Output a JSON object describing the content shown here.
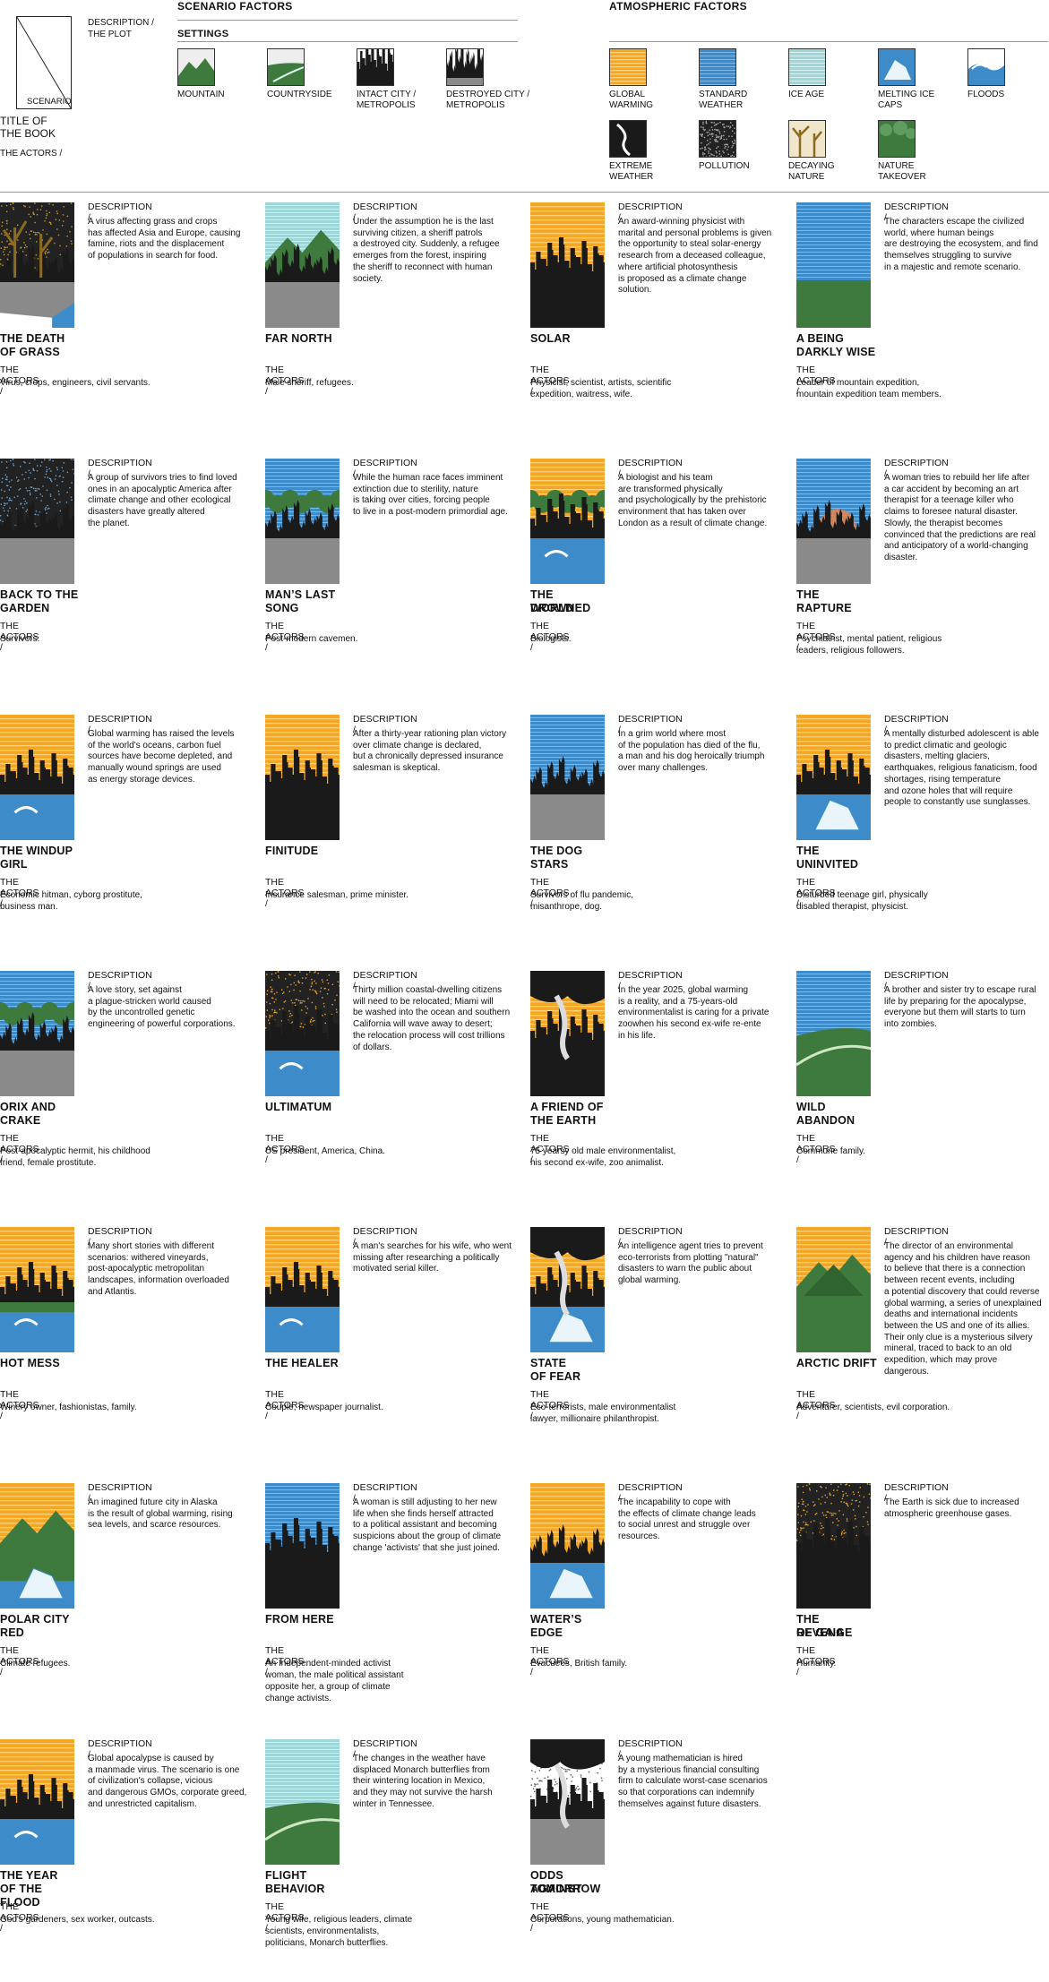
{
  "legend": {
    "description_label": "DESCRIPTION /",
    "plot_label": "THE PLOT",
    "scenario_label": "SCENARIO",
    "title_label_1": "TITLE OF",
    "title_label_2": "THE BOOK",
    "actors_label": "THE ACTORS /"
  },
  "scenario_factors": {
    "heading": "SCENARIO FACTORS",
    "settings_heading": "SETTINGS",
    "settings": [
      {
        "icon": "mountain-icon",
        "label_1": "MOUNTAIN",
        "label_2": ""
      },
      {
        "icon": "countryside-icon",
        "label_1": "COUNTRYSIDE",
        "label_2": ""
      },
      {
        "icon": "intact-city-icon",
        "label_1": "INTACT CITY /",
        "label_2": "METROPOLIS"
      },
      {
        "icon": "destroyed-city-icon",
        "label_1": "DESTROYED CITY /",
        "label_2": "METROPOLIS"
      }
    ]
  },
  "atmospheric_factors": {
    "heading": "ATMOSPHERIC FACTORS",
    "items": [
      {
        "icon": "global-warming-icon",
        "label_1": "GLOBAL",
        "label_2": "WARMING"
      },
      {
        "icon": "standard-weather-icon",
        "label_1": "STANDARD",
        "label_2": "WEATHER"
      },
      {
        "icon": "ice-age-icon",
        "label_1": "ICE AGE",
        "label_2": ""
      },
      {
        "icon": "melting-ice-caps-icon",
        "label_1": "MELTING ICE",
        "label_2": "CAPS"
      },
      {
        "icon": "floods-icon",
        "label_1": "FLOODS",
        "label_2": ""
      },
      {
        "icon": "extreme-weather-icon",
        "label_1": "EXTREME",
        "label_2": "WEATHER"
      },
      {
        "icon": "pollution-icon",
        "label_1": "POLLUTION",
        "label_2": ""
      },
      {
        "icon": "decaying-nature-icon",
        "label_1": "DECAYING",
        "label_2": "NATURE"
      },
      {
        "icon": "nature-takeover-icon",
        "label_1": "NATURE",
        "label_2": "TAKEOVER"
      }
    ]
  },
  "colors": {
    "orange": "#f5a623",
    "blue": "#3d8cc9",
    "light_blue": "#9fd6d8",
    "green": "#3e7a3e",
    "gray": "#8a8a8a",
    "black": "#1a1a1a",
    "decay": "#8c6b1f",
    "red": "#d9351c"
  },
  "desc_label": "DESCRIPTION /",
  "actors_label": "THE ACTORS /",
  "books": [
    {
      "t1": "THE DEATH",
      "t2": "OF GRASS",
      "desc": [
        "A virus affecting grass and crops",
        "has affected Asia and Europe, causing",
        "famine, riots and  the displacement",
        "of populations in search for food."
      ],
      "actors": [
        "Virus, crops, engineers, civil servants."
      ],
      "sky": "decay",
      "ground": "gray",
      "city": "destroyed",
      "extra": "decay"
    },
    {
      "t1": "FAR NORTH",
      "t2": "",
      "desc": [
        "Under the assumption he is the last",
        "surviving citizen, a sheriff  patrols",
        "a destroyed city. Suddenly, a refugee",
        "emerges from the forest, inspiring",
        "the sheriff to reconnect with human",
        "society."
      ],
      "actors": [
        "Male sheriff, refugees."
      ],
      "sky": "lightblue",
      "ground": "gray",
      "city": "destroyed",
      "extra": "mountain"
    },
    {
      "t1": "SOLAR",
      "t2": "",
      "desc": [
        "An award-winning physicist with",
        "marital and personal problems is given",
        "the opportunity to steal solar-energy",
        "research from a deceased colleague,",
        "where artificial photosynthesis",
        "is proposed as a climate change",
        "solution."
      ],
      "actors": [
        "Physicist, scientist, artists, scientific",
        "expedition, waitress, wife."
      ],
      "sky": "orange",
      "ground": "black",
      "city": "intact",
      "extra": ""
    },
    {
      "t1": "A BEING",
      "t2": "DARKLY WISE",
      "desc": [
        "The characters escape the civilized",
        "world, where human beings",
        "are destroying the ecosystem, and find",
        "themselves struggling to survive",
        "in a majestic and remote scenario."
      ],
      "actors": [
        "Leader of mountain expedition,",
        "mountain expedition team members."
      ],
      "sky": "blue",
      "ground": "green",
      "city": "",
      "extra": "bear"
    },
    {
      "t1": "BACK TO THE",
      "t2": "GARDEN",
      "desc": [
        "A group of survivors tries to find loved",
        "ones in an apocalyptic America after",
        "climate change and other ecological",
        "disasters have greatly altered",
        "the planet."
      ],
      "actors": [
        "Survivors."
      ],
      "sky": "pollution",
      "ground": "gray",
      "city": "destroyed",
      "extra": ""
    },
    {
      "t1": "MAN’S LAST",
      "t2": "SONG",
      "desc": [
        "While the human race faces imminent",
        "extinction due to sterility, nature",
        "is taking over cities, forcing people",
        "to live in a post-modern primordial age."
      ],
      "actors": [
        "Post-modern cavemen."
      ],
      "sky": "blue",
      "ground": "gray",
      "city": "destroyed",
      "extra": "jungle"
    },
    {
      "t1": "THE DROWNED",
      "t2": "WORLD",
      "desc": [
        "A biologist and his team",
        "are transformed physically",
        "and psychologically by the prehistoric",
        "environment that has taken over",
        "London as a result of climate change."
      ],
      "actors": [
        "Biologists."
      ],
      "sky": "orange",
      "ground": "blue",
      "city": "intact",
      "extra": "jungle-croc"
    },
    {
      "t1": "THE RAPTURE",
      "t2": "",
      "desc": [
        "A woman tries to rebuild her life after",
        "a car accident by becoming an art",
        "therapist for a teenage killer who",
        "claims to foresee natural disaster.",
        "Slowly, the therapist becomes",
        "convinced that the predictions are real",
        "and anticipatory of a world-changing",
        "disaster."
      ],
      "actors": [
        "Psychiatrist, mental patient, religious",
        "leaders, religious followers."
      ],
      "sky": "bluesun",
      "ground": "gray",
      "city": "destroyed",
      "extra": ""
    },
    {
      "t1": "THE WINDUP",
      "t2": "GIRL",
      "desc": [
        "Global warming has raised the levels",
        "of the world's oceans, carbon fuel",
        "sources have become depleted, and",
        "manually wound springs are used",
        "as energy storage devices."
      ],
      "actors": [
        "Economic hitman, cyborg prostitute,",
        "business man."
      ],
      "sky": "orange",
      "ground": "blue",
      "city": "intact",
      "extra": "wave"
    },
    {
      "t1": "FINITUDE",
      "t2": "",
      "desc": [
        "After a thirty-year rationing plan victory",
        "over climate change is declared,",
        "but a chronically depressed insurance",
        "salesman is skeptical."
      ],
      "actors": [
        "Insurance salesman, prime minister."
      ],
      "sky": "orange",
      "ground": "black",
      "city": "intact",
      "extra": "tiger"
    },
    {
      "t1": "THE DOG",
      "t2": "STARS",
      "desc": [
        "In a grim world where most",
        "of the population has died of the flu,",
        "a man and his dog heroically triumph",
        "over many challenges."
      ],
      "actors": [
        "Survivors of flu pandemic,",
        "misanthrope, dog."
      ],
      "sky": "blue",
      "ground": "gray",
      "city": "destroyed",
      "extra": "plane-dog"
    },
    {
      "t1": "THE",
      "t2": "UNINVITED",
      "desc": [
        "A mentally disturbed adolescent is able",
        "to predict climatic and geologic",
        "disasters, melting glaciers,",
        "earthquakes, religious fanaticism, food",
        "shortages, rising temperature",
        "and ozone holes that will require",
        "people to constantly use sunglasses."
      ],
      "actors": [
        "Disturbed teenage girl, physically",
        "disabled therapist, physicist."
      ],
      "sky": "orange",
      "ground": "blue",
      "city": "intact",
      "extra": "ice"
    },
    {
      "t1": "ORIX AND",
      "t2": "CRAKE",
      "desc": [
        "A love story, set against",
        "a plague-stricken world caused",
        "by the uncontrolled genetic",
        "engineering of powerful corporations."
      ],
      "actors": [
        "Post-apocalyptic hermit, his childhood",
        "friend, female prostitute."
      ],
      "sky": "blue",
      "ground": "gray",
      "city": "destroyed",
      "extra": "jungle-dog"
    },
    {
      "t1": "ULTIMATUM",
      "t2": "",
      "desc": [
        "Thirty million coastal-dwelling citizens",
        "will need to be relocated; Miami will",
        "be washed into the ocean and southern",
        "California will wave away to desert;",
        "the relocation process will cost trillions",
        "of dollars."
      ],
      "actors": [
        "US president, America, China."
      ],
      "sky": "pollution-orange",
      "ground": "blue",
      "city": "intact",
      "extra": "wave"
    },
    {
      "t1": "A FRIEND OF",
      "t2": "THE EARTH",
      "desc": [
        "In the year 2025, global warming",
        "is a reality, and a 75-years-old",
        "environmentalist is caring for a private",
        "zoowhen his second ex-wife re-ente",
        "in his life."
      ],
      "actors": [
        "75 yearsy old male environmentalist,",
        "his second ex-wife, zoo animalist."
      ],
      "sky": "orange-storm",
      "ground": "black",
      "city": "intact",
      "extra": "tornado"
    },
    {
      "t1": "WILD",
      "t2": "ABANDON",
      "desc": [
        "A brother and sister try to escape rural",
        "life by preparing for the apocalypse,",
        "everyone but them will starts to turn",
        "into zombies."
      ],
      "actors": [
        "Commune family."
      ],
      "sky": "blue",
      "ground": "green",
      "city": "",
      "extra": "hill"
    },
    {
      "t1": "HOT MESS",
      "t2": "",
      "desc": [
        "Many short stories with different",
        "scenarios: withered vineyards,",
        "post-apocalyptic metropolitan",
        "landscapes, information overloaded",
        "and Atlantis."
      ],
      "actors": [
        "Winery owner, fashionistas, family."
      ],
      "sky": "orange",
      "ground": "blue",
      "city": "intact",
      "extra": "wave-green"
    },
    {
      "t1": "THE HEALER",
      "t2": "",
      "desc": [
        "A man's searches for his wife, who went",
        "missing after researching a politically",
        "motivated serial killer."
      ],
      "actors": [
        "Couple, newspaper journalist."
      ],
      "sky": "orange",
      "ground": "blue",
      "city": "intact",
      "extra": "redfish"
    },
    {
      "t1": "STATE",
      "t2": "OF FEAR",
      "desc": [
        "An intelligence agent tries to prevent",
        "eco-terrorists from plotting \"natural\"",
        "disasters to warn the public about",
        "global warming."
      ],
      "actors": [
        "Eco-terrorists, male environmentalist",
        "lawyer, millionaire philanthropist."
      ],
      "sky": "orange-storm",
      "ground": "blue",
      "city": "intact",
      "extra": "ice-tornado"
    },
    {
      "t1": "ARCTIC DRIFT",
      "t2": "",
      "desc": [
        "The director of an environmental",
        "agency and his children have reason",
        "to believe that there is a connection",
        "between recent events, including",
        "a potential discovery that could reverse",
        "global warming, a series of unexplained",
        "deaths and  international incidents",
        "between the US and one of its allies.",
        "Their only clue is a mysterious silvery",
        "mineral, traced to back to an old",
        "expedition, which may prove",
        "dangerous."
      ],
      "actors": [
        "Adventurer, scientists, evil corporation."
      ],
      "sky": "orange",
      "ground": "green",
      "city": "",
      "extra": "mountain-big"
    },
    {
      "t1": "POLAR CITY",
      "t2": "RED",
      "desc": [
        "An imagined future city in Alaska",
        "is the result of global warming, rising",
        "sea levels, and scarce resources."
      ],
      "actors": [
        "Climate refugees."
      ],
      "sky": "orange",
      "ground": "blue",
      "city": "",
      "extra": "mountain-ice"
    },
    {
      "t1": "FROM HERE",
      "t2": "",
      "desc": [
        "A woman is still adjusting to her new",
        "life when she finds herself attracted",
        "to a political assistant and becoming",
        "suspicions about the group of climate",
        "change 'activists' that she just joined."
      ],
      "actors": [
        "An Independent-minded activist",
        "woman, the male political assistant",
        "opposite her, a group of climate",
        "change activists."
      ],
      "sky": "blue",
      "ground": "black",
      "city": "intact",
      "extra": ""
    },
    {
      "t1": "WATER’S",
      "t2": "EDGE",
      "desc": [
        "The incapability to cope with",
        "the effects of climate change leads",
        "to social unrest and struggle over",
        "resources."
      ],
      "actors": [
        "Evacuees, British family."
      ],
      "sky": "orange",
      "ground": "blue",
      "city": "destroyed",
      "extra": "ice"
    },
    {
      "t1": "THE REVENGE",
      "t2": "OF GAIA",
      "desc": [
        "The Earth is sick due to increased",
        "atmospheric greenhouse gases."
      ],
      "actors": [
        "Humanity."
      ],
      "sky": "pollution-orange",
      "ground": "black",
      "city": "intact",
      "extra": ""
    },
    {
      "t1": "THE YEAR",
      "t2": "OF THE FLOOD",
      "desc": [
        "Global apocalypse is caused by",
        "a manmade virus. The scenario is one",
        "of civilization's collapse, vicious",
        "and dangerous GMOs, corporate greed,",
        "and unrestricted capitalism."
      ],
      "actors": [
        "God's gardeners, sex worker, outcasts."
      ],
      "sky": "orange",
      "ground": "blue",
      "city": "intact",
      "extra": "wave-dog"
    },
    {
      "t1": "FLIGHT",
      "t2": "BEHAVIOR",
      "desc": [
        "The changes in the weather have",
        "displaced Monarch butterflies from",
        "their wintering location in Mexico,",
        "and they may not survive the harsh",
        "winter in Tennessee."
      ],
      "actors": [
        "Young wife, religious leaders, climate",
        "scientists, environmentalists,",
        "politicians, Monarch butterflies."
      ],
      "sky": "lightblue",
      "ground": "green",
      "city": "",
      "extra": "butterfly"
    },
    {
      "t1": "ODDS AGAINST",
      "t2": "TOMORROW",
      "desc": [
        "A young mathematician is hired",
        "by a mysterious financial consulting",
        "firm to calculate worst-case scenarios",
        "so that corporations can indemnify",
        "themselves against future disasters."
      ],
      "actors": [
        "Corporations, young mathematician."
      ],
      "sky": "pollution-storm",
      "ground": "gray",
      "city": "intact",
      "extra": "tornado"
    }
  ]
}
